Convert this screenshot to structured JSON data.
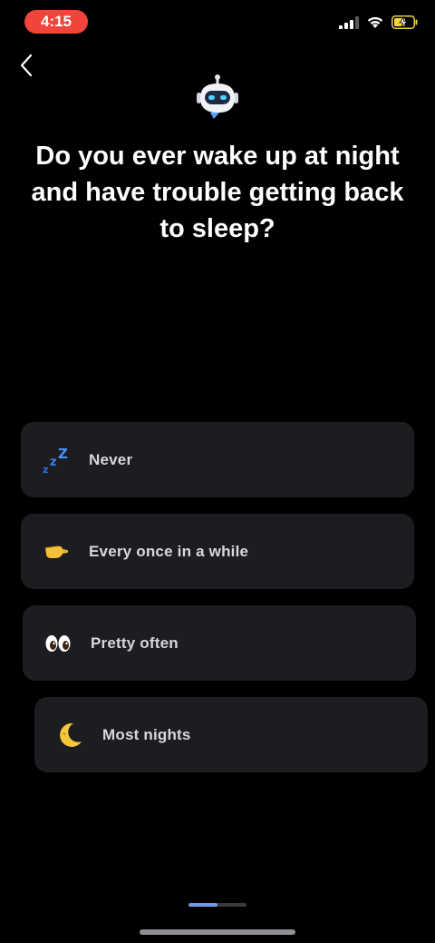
{
  "status_bar": {
    "time": "4:15",
    "time_pill_color": "#f2443a",
    "icons": [
      "cellular-signal-icon",
      "wifi-icon",
      "battery-charging-icon"
    ]
  },
  "header": {
    "back_icon": "chevron-left-icon",
    "logo_icon": "robot-chat-icon"
  },
  "question": {
    "text": "Do you ever wake up at night and have trouble getting back to sleep?"
  },
  "options": [
    {
      "label": "Never",
      "icon": "zzz-icon"
    },
    {
      "label": "Every once in a while",
      "icon": "pinching-hand-icon"
    },
    {
      "label": "Pretty often",
      "icon": "eyes-icon"
    },
    {
      "label": "Most nights",
      "icon": "crescent-moon-icon"
    }
  ],
  "progress": {
    "fraction": 0.5,
    "accent": "#6f9be8"
  },
  "colors": {
    "background": "#000000",
    "card": "#1c1d20",
    "text": "#ffffff",
    "option_text": "#d8d8dc"
  }
}
